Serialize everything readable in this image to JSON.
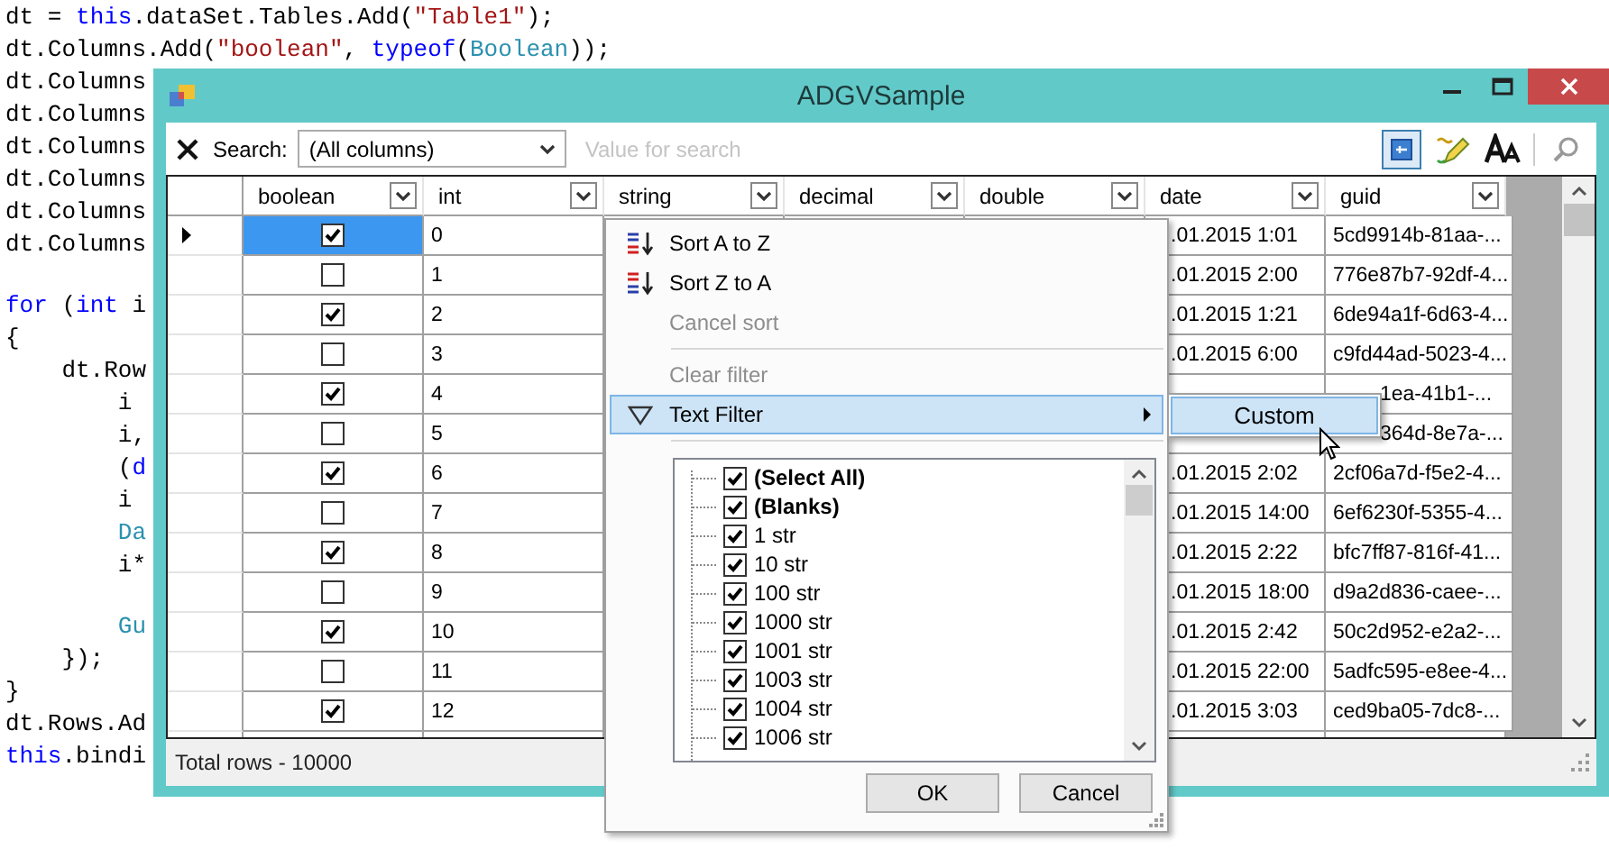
{
  "code_blocks": [
    {
      "lines": [
        {
          "segments": [
            {
              "text": "dt = ",
              "kind": "plain"
            },
            {
              "text": "this",
              "kind": "keyword"
            },
            {
              "text": ".dataSet.Tables.Add(",
              "kind": "plain"
            },
            {
              "text": "\"Table1\"",
              "kind": "string"
            },
            {
              "text": ");",
              "kind": "plain"
            }
          ]
        },
        {
          "segments": [
            {
              "text": "dt.Columns.Add(",
              "kind": "plain"
            },
            {
              "text": "\"boolean\"",
              "kind": "string"
            },
            {
              "text": ", ",
              "kind": "plain"
            },
            {
              "text": "typeof",
              "kind": "keyword"
            },
            {
              "text": "(",
              "kind": "plain"
            },
            {
              "text": "Boolean",
              "kind": "type"
            },
            {
              "text": "));",
              "kind": "plain"
            }
          ]
        },
        {
          "segments": [
            {
              "text": "dt.Columns",
              "kind": "plain"
            }
          ]
        },
        {
          "segments": [
            {
              "text": "dt.Columns",
              "kind": "plain"
            }
          ]
        },
        {
          "segments": [
            {
              "text": "dt.Columns",
              "kind": "plain"
            }
          ]
        },
        {
          "segments": [
            {
              "text": "dt.Columns",
              "kind": "plain"
            }
          ]
        },
        {
          "segments": [
            {
              "text": "dt.Columns",
              "kind": "plain"
            }
          ]
        },
        {
          "segments": [
            {
              "text": "dt.Columns",
              "kind": "plain"
            }
          ]
        }
      ]
    },
    {
      "lines": [
        {
          "segments": [
            {
              "text": "for",
              "kind": "keyword"
            },
            {
              "text": " (",
              "kind": "plain"
            },
            {
              "text": "int",
              "kind": "keyword"
            },
            {
              "text": " i",
              "kind": "plain"
            }
          ]
        },
        {
          "segments": [
            {
              "text": "{",
              "kind": "plain"
            }
          ]
        },
        {
          "segments": [
            {
              "text": "    dt.Row",
              "kind": "plain"
            }
          ]
        },
        {
          "segments": [
            {
              "text": "        i",
              "kind": "plain"
            }
          ]
        },
        {
          "segments": [
            {
              "text": "        i,",
              "kind": "plain"
            }
          ]
        },
        {
          "segments": [
            {
              "text": "        (",
              "kind": "plain"
            },
            {
              "text": "d",
              "kind": "keyword"
            }
          ]
        },
        {
          "segments": [
            {
              "text": "        i",
              "kind": "plain"
            }
          ]
        },
        {
          "segments": [
            {
              "text": "        Da",
              "kind": "type"
            }
          ]
        },
        {
          "segments": [
            {
              "text": "        i*",
              "kind": "plain"
            }
          ]
        }
      ]
    },
    {
      "lines": [
        {
          "segments": [
            {
              "text": "        Gu",
              "kind": "type"
            }
          ]
        },
        {
          "segments": [
            {
              "text": "    });",
              "kind": "plain"
            }
          ]
        },
        {
          "segments": [
            {
              "text": "}",
              "kind": "plain"
            }
          ]
        },
        {
          "segments": [
            {
              "text": "dt.Rows.Ad",
              "kind": "plain"
            }
          ]
        },
        {
          "segments": [
            {
              "text": "this",
              "kind": "keyword"
            },
            {
              "text": ".bindi",
              "kind": "plain"
            }
          ]
        }
      ]
    }
  ],
  "window": {
    "title": "ADGVSample"
  },
  "toolbar": {
    "search_label": "Search:",
    "column_select": {
      "value": "(All columns)"
    },
    "search_field": {
      "placeholder": "Value for search"
    }
  },
  "grid": {
    "columns": [
      {
        "label": "boolean"
      },
      {
        "label": "int"
      },
      {
        "label": "string"
      },
      {
        "label": "decimal"
      },
      {
        "label": "double"
      },
      {
        "label": "date"
      },
      {
        "label": "guid"
      }
    ],
    "rows": [
      {
        "current": true,
        "selected": true,
        "checked": true,
        "int": "0",
        "date": ".01.2015 1:01",
        "guid": "5cd9914b-81aa-..."
      },
      {
        "current": false,
        "selected": false,
        "checked": false,
        "int": "1",
        "date": ".01.2015 2:00",
        "guid": "776e87b7-92df-4..."
      },
      {
        "current": false,
        "selected": false,
        "checked": true,
        "int": "2",
        "date": ".01.2015 1:21",
        "guid": "6de94a1f-6d63-4..."
      },
      {
        "current": false,
        "selected": false,
        "checked": false,
        "int": "3",
        "date": ".01.2015 6:00",
        "guid": "c9fd44ad-5023-4..."
      },
      {
        "current": false,
        "selected": false,
        "checked": true,
        "int": "4",
        "guid": "1ea-41b1-..."
      },
      {
        "current": false,
        "selected": false,
        "checked": false,
        "int": "5",
        "guid": "364d-8e7a-..."
      },
      {
        "current": false,
        "selected": false,
        "checked": true,
        "int": "6",
        "date": ".01.2015 2:02",
        "guid": "2cf06a7d-f5e2-4..."
      },
      {
        "current": false,
        "selected": false,
        "checked": false,
        "int": "7",
        "date": ".01.2015 14:00",
        "guid": "6ef6230f-5355-4..."
      },
      {
        "current": false,
        "selected": false,
        "checked": true,
        "int": "8",
        "date": ".01.2015 2:22",
        "guid": "bfc7ff87-816f-41..."
      },
      {
        "current": false,
        "selected": false,
        "checked": false,
        "int": "9",
        "date": ".01.2015 18:00",
        "guid": "d9a2d836-caee-..."
      },
      {
        "current": false,
        "selected": false,
        "checked": true,
        "int": "10",
        "date": ".01.2015 2:42",
        "guid": "50c2d952-e2a2-..."
      },
      {
        "current": false,
        "selected": false,
        "checked": false,
        "int": "11",
        "date": ".01.2015 22:00",
        "guid": "5adfc595-e8ee-4..."
      },
      {
        "current": false,
        "selected": false,
        "checked": true,
        "int": "12",
        "date": ".01.2015 3:03",
        "guid": "ced9ba05-7dc8-..."
      }
    ]
  },
  "status_bar": {
    "text": "Total rows - 10000"
  },
  "filter_menu": {
    "items": [
      {
        "kind": "sort_asc",
        "label": "Sort A to Z",
        "disabled": false,
        "selected": false
      },
      {
        "kind": "sort_desc",
        "label": "Sort Z to A",
        "disabled": false,
        "selected": false
      },
      {
        "kind": "plain",
        "label": "Cancel sort",
        "disabled": true,
        "selected": false
      },
      {
        "kind": "separator"
      },
      {
        "kind": "plain",
        "label": "Clear filter",
        "disabled": true,
        "selected": false
      },
      {
        "kind": "submenu",
        "label": "Text Filter",
        "disabled": false,
        "selected": true
      }
    ],
    "values": [
      {
        "kind": "special",
        "label": "(Select All)",
        "checked": true
      },
      {
        "kind": "special",
        "label": "(Blanks)",
        "checked": true
      },
      {
        "kind": "value",
        "label": "1 str",
        "checked": true
      },
      {
        "kind": "value",
        "label": "10 str",
        "checked": true
      },
      {
        "kind": "value",
        "label": "100 str",
        "checked": true
      },
      {
        "kind": "value",
        "label": "1000 str",
        "checked": true
      },
      {
        "kind": "value",
        "label": "1001 str",
        "checked": true
      },
      {
        "kind": "value",
        "label": "1003 str",
        "checked": true
      },
      {
        "kind": "value",
        "label": "1004 str",
        "checked": true
      },
      {
        "kind": "value",
        "label": "1006 str",
        "checked": true
      }
    ],
    "buttons": [
      {
        "label": "OK"
      },
      {
        "label": "Cancel"
      }
    ]
  },
  "submenu": {
    "items": [
      {
        "label": "Custom",
        "selected": true
      }
    ]
  }
}
